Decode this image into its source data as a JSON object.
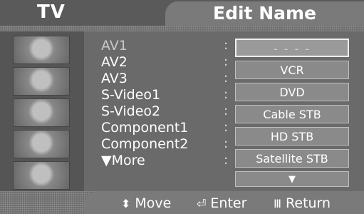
{
  "header": {
    "mode": "TV",
    "title": "Edit Name"
  },
  "inputs": [
    {
      "label": "AV1",
      "value": "- - - -"
    },
    {
      "label": "AV2",
      "value": "VCR"
    },
    {
      "label": "AV3",
      "value": "DVD"
    },
    {
      "label": "S-Video1",
      "value": "Cable STB"
    },
    {
      "label": "S-Video2",
      "value": "HD STB"
    },
    {
      "label": "Component1",
      "value": "Satellite STB"
    },
    {
      "label": "Component2",
      "value": ""
    },
    {
      "label": "▼More",
      "value": ""
    }
  ],
  "colon": ":",
  "more_arrow": "▼",
  "footer": {
    "move": {
      "icon": "⬍",
      "label": "Move"
    },
    "enter": {
      "icon": "⏎",
      "label": "Enter"
    },
    "return": {
      "icon": "Ⅲ",
      "label": "Return"
    }
  }
}
